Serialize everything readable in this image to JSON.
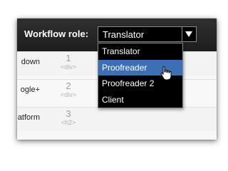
{
  "workflow": {
    "label": "Workflow role:",
    "selected_value": "Translator",
    "options": [
      "Translator",
      "Proofreader",
      "Proofreader 2",
      "Client"
    ],
    "highlighted_option": "Proofreader"
  },
  "rows": [
    {
      "name": "down",
      "number": "1",
      "tag": "<div>"
    },
    {
      "name": "ogle+",
      "number": "2",
      "tag": "<div>"
    },
    {
      "name": "atform",
      "number": "3",
      "tag": "<h2>"
    }
  ],
  "icons": {
    "dropdown_arrow": "chevron-down-icon",
    "pointer": "hand-pointer-icon"
  },
  "colors": {
    "header_bg": "#262626",
    "select_bg": "#000000",
    "highlight": "#3c6fb3",
    "row_number": "#a0a0a0"
  }
}
